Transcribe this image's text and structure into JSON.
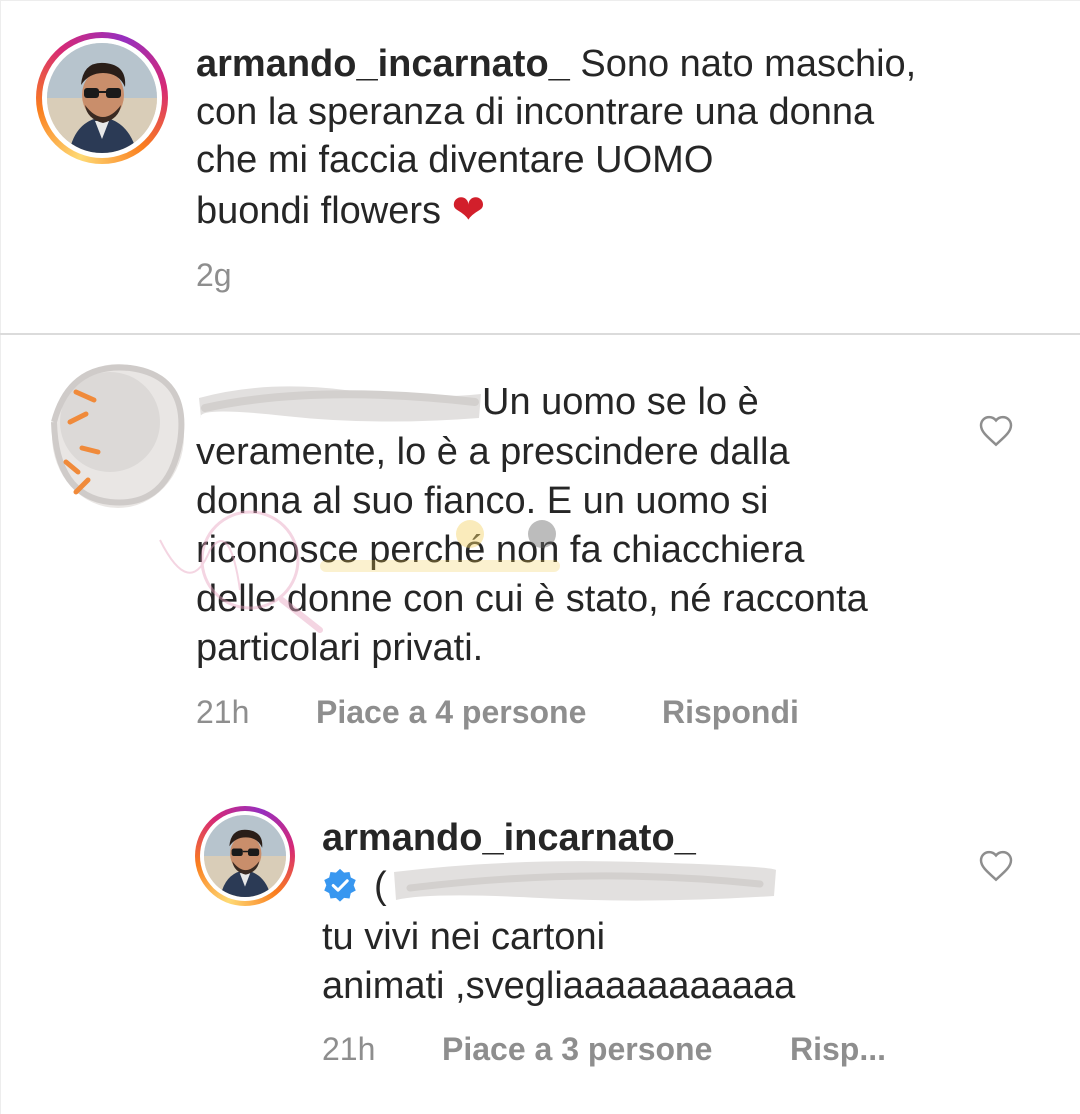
{
  "caption": {
    "username": "armando_incarnato_",
    "lines": [
      "Sono nato maschio,",
      "con la speranza di incontrare una donna",
      "che mi faccia diventare UOMO",
      "buondi flowers"
    ],
    "emoji": "❤",
    "time": "2g"
  },
  "comment": {
    "lines": [
      "Un uomo se lo è",
      "veramente, lo è a prescindere dalla",
      "donna al suo fianco. E un uomo si",
      "riconosce perché non fa chiacchiera",
      "delle donne con cui è stato, né racconta",
      "particolari privati."
    ],
    "time": "21h",
    "likes": "Piace a 4 persone",
    "reply": "Rispondi",
    "like_icon": "heart-outline"
  },
  "reply": {
    "username": "armando_incarnato_",
    "mention_prefix": "(",
    "lines": [
      "tu vivi nei cartoni",
      "animati ,svegliaaaaaaaaaaa"
    ],
    "time": "21h",
    "likes": "Piace a 3 persone",
    "reply": "Risp...",
    "verified_icon": "verified-badge",
    "like_icon": "heart-outline"
  },
  "colors": {
    "text": "#262626",
    "secondary": "#8e8e8e",
    "verified": "#3897f0",
    "emoji_red": "#d21f2b",
    "divider": "#dbdbdb"
  }
}
